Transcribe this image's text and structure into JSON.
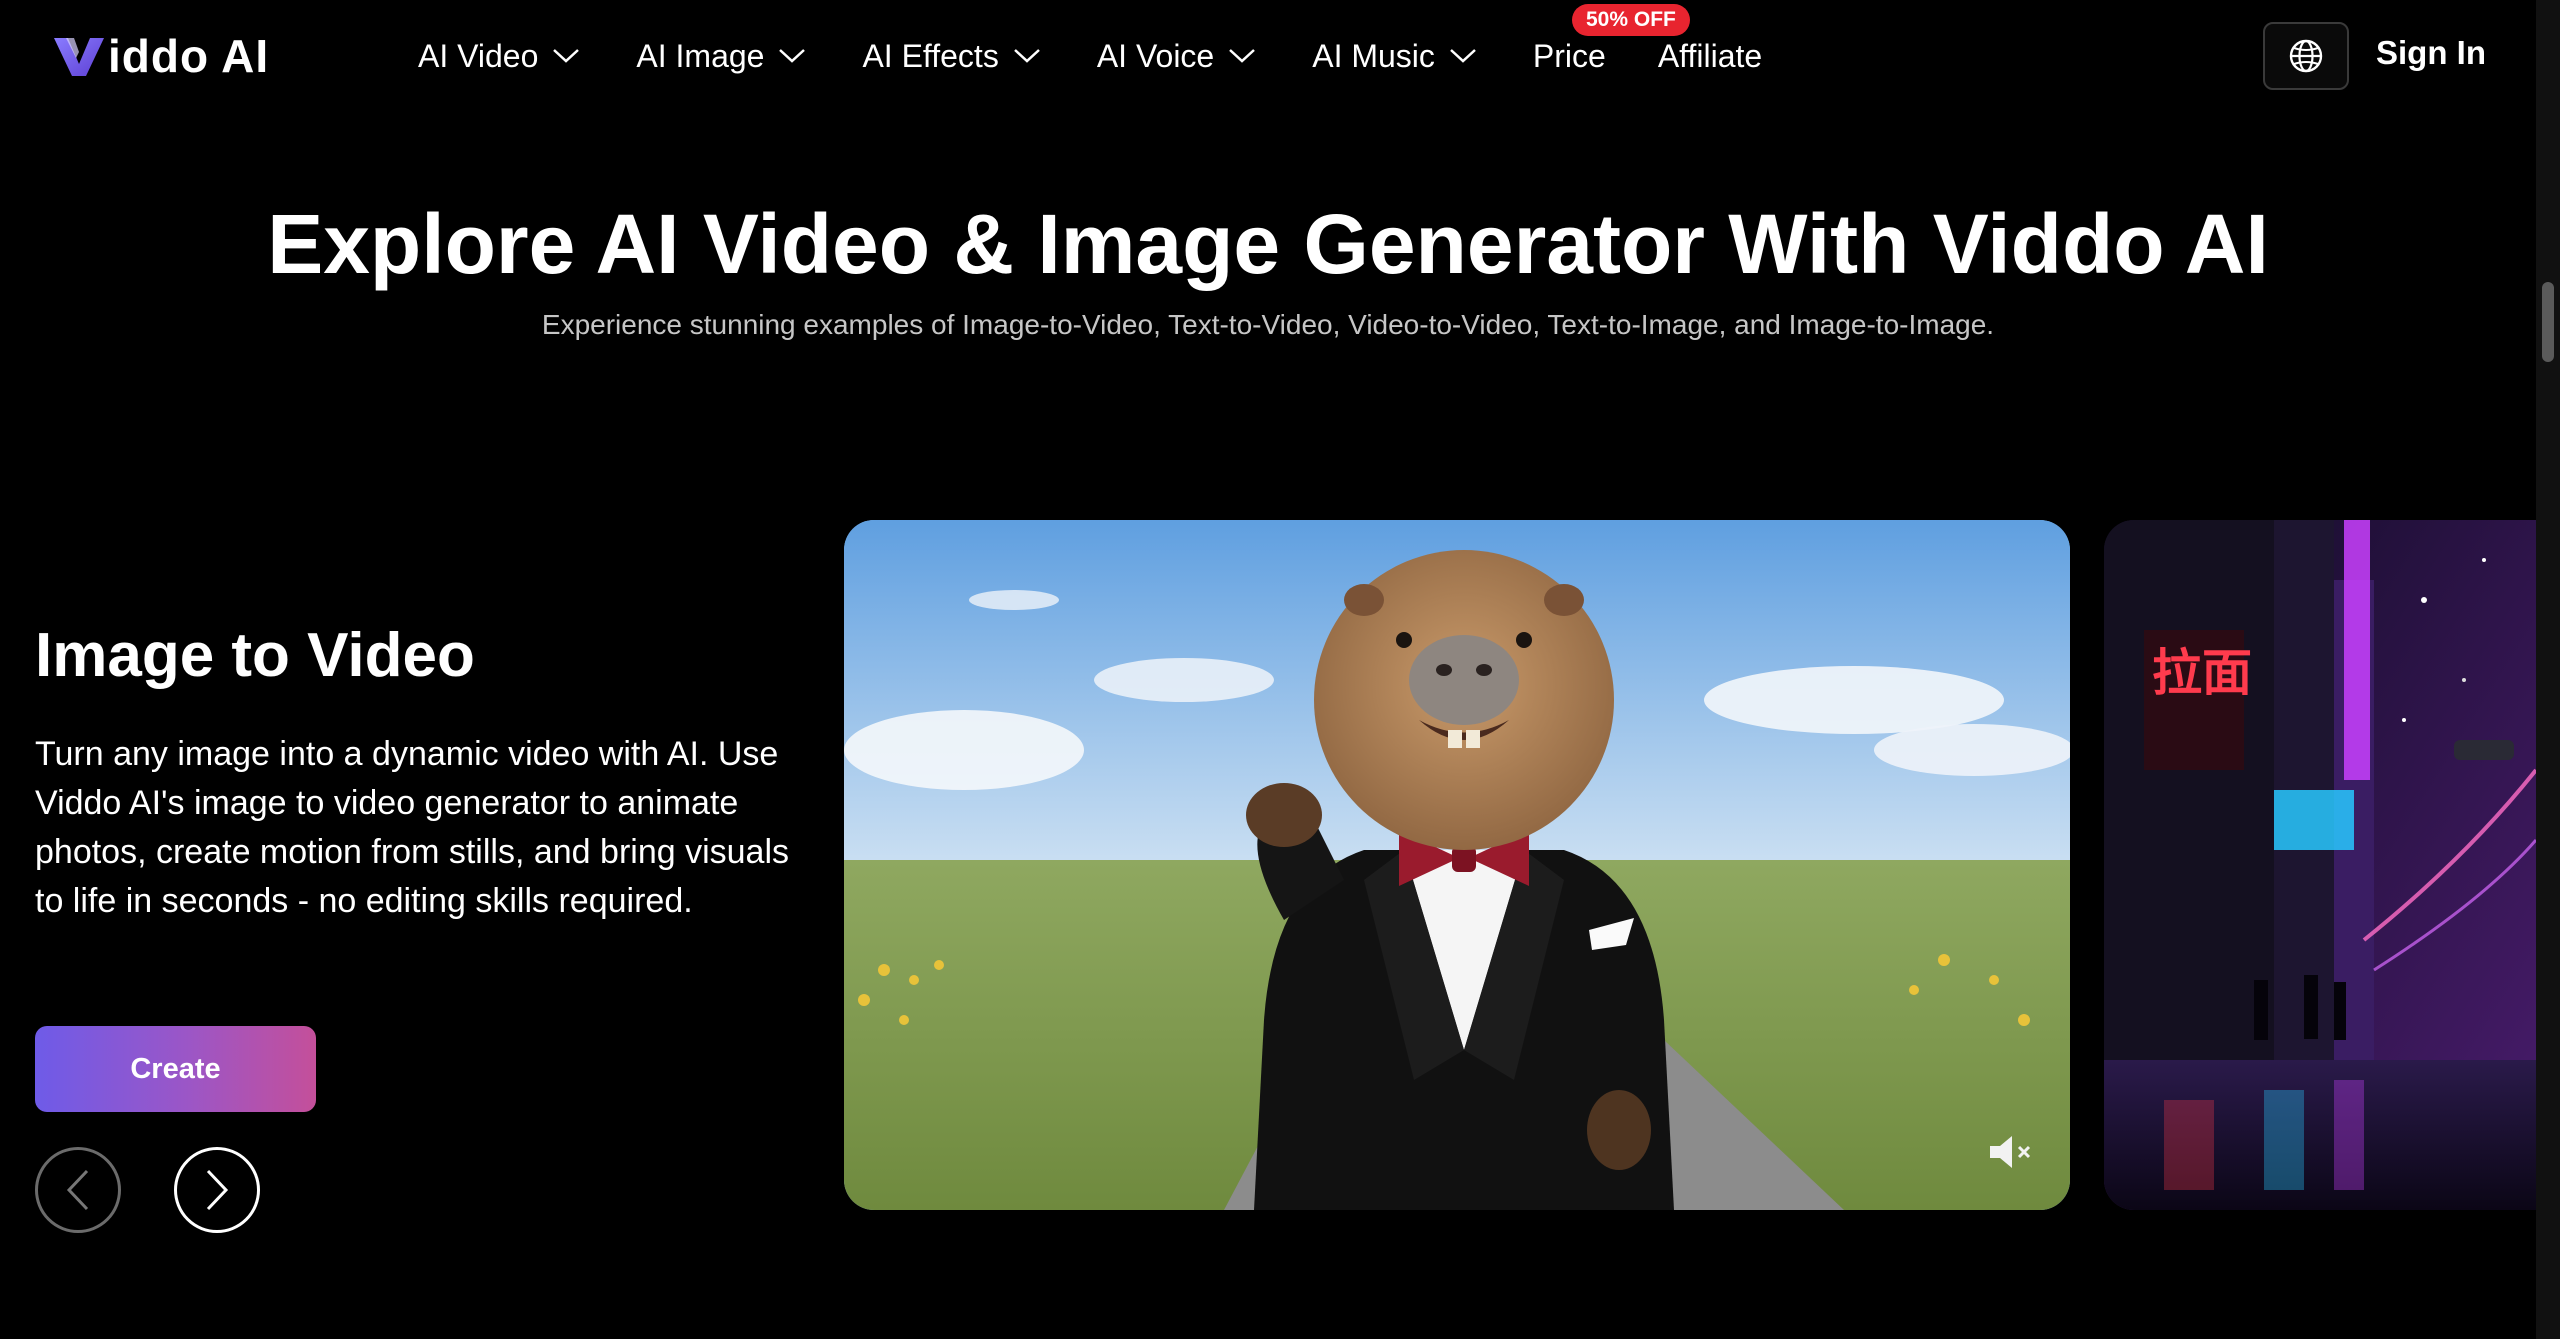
{
  "header": {
    "logo_text": "iddo AI",
    "nav": [
      {
        "label": "AI Video"
      },
      {
        "label": "AI Image"
      },
      {
        "label": "AI Effects"
      },
      {
        "label": "AI Voice"
      },
      {
        "label": "AI Music"
      }
    ],
    "price_label": "Price",
    "price_badge": "50% OFF",
    "affiliate_label": "Affiliate",
    "signin_label": "Sign In"
  },
  "hero": {
    "title": "Explore AI Video & Image Generator With Viddo AI",
    "subtitle": "Experience stunning examples of Image-to-Video, Text-to-Video, Video-to-Video, Text-to-Image, and Image-to-Image."
  },
  "feature": {
    "title": "Image to Video",
    "description": "Turn any image into a dynamic video with AI. Use Viddo AI's image to video generator to animate photos, create motion from stills, and bring visuals to life in seconds - no editing skills required.",
    "create_label": "Create"
  },
  "side_card": {
    "sign_text": "拉面"
  },
  "colors": {
    "background": "#000000",
    "badge": "#e8242f",
    "create_gradient_start": "#6e5be8",
    "create_gradient_end": "#c44f9a"
  },
  "icons": {
    "language": "globe-icon",
    "dropdown": "chevron-down-icon",
    "prev": "chevron-left-icon",
    "next": "chevron-right-icon",
    "mute": "mute-icon"
  }
}
